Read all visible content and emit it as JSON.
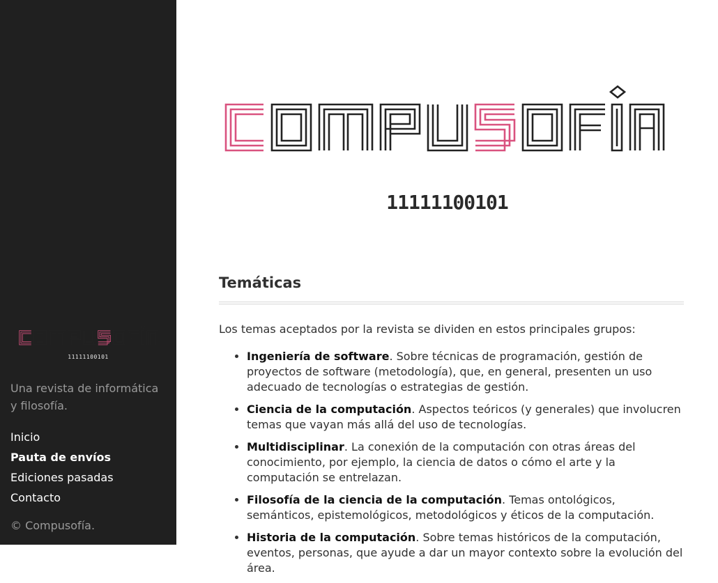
{
  "brand": {
    "logo_text": "COMPUSOFÍA",
    "binary": "11111100101",
    "accent_color": "#d9527f",
    "ink_color": "#222222"
  },
  "sidebar": {
    "tagline": "Una revista de informática y filosofía.",
    "nav": [
      {
        "label": "Inicio",
        "active": false
      },
      {
        "label": "Pauta de envíos",
        "active": true
      },
      {
        "label": "Ediciones pasadas",
        "active": false
      },
      {
        "label": "Contacto",
        "active": false
      }
    ],
    "copyright": "© Compusofía."
  },
  "main": {
    "section_title": "Temáticas",
    "intro": "Los temas aceptados por la revista se dividen en estos principales grupos:",
    "topics": [
      {
        "title": "Ingeniería de software",
        "text": ". Sobre técnicas de programación, gestión de proyectos de software (metodología), que, en general, presenten un uso adecuado de tecnologías o estrategias de gestión."
      },
      {
        "title": "Ciencia de la computación",
        "text": ". Aspectos teóricos (y generales) que involucren temas que vayan más allá del uso de tecnologías."
      },
      {
        "title": "Multidisciplinar",
        "text": ". La conexión de la computación con otras áreas del conocimiento, por ejemplo, la ciencia de datos o cómo el arte y la computación se entrelazan."
      },
      {
        "title": "Filosofía de la ciencia de la computación",
        "text": ". Temas ontológicos, semánticos, epistemológicos, metodológicos y éticos de la computación."
      },
      {
        "title": "Historia de la computación",
        "text": ". Sobre temas históricos de la computación, eventos, personas, que ayude a dar un mayor contexto sobre la evolución del área."
      }
    ]
  }
}
